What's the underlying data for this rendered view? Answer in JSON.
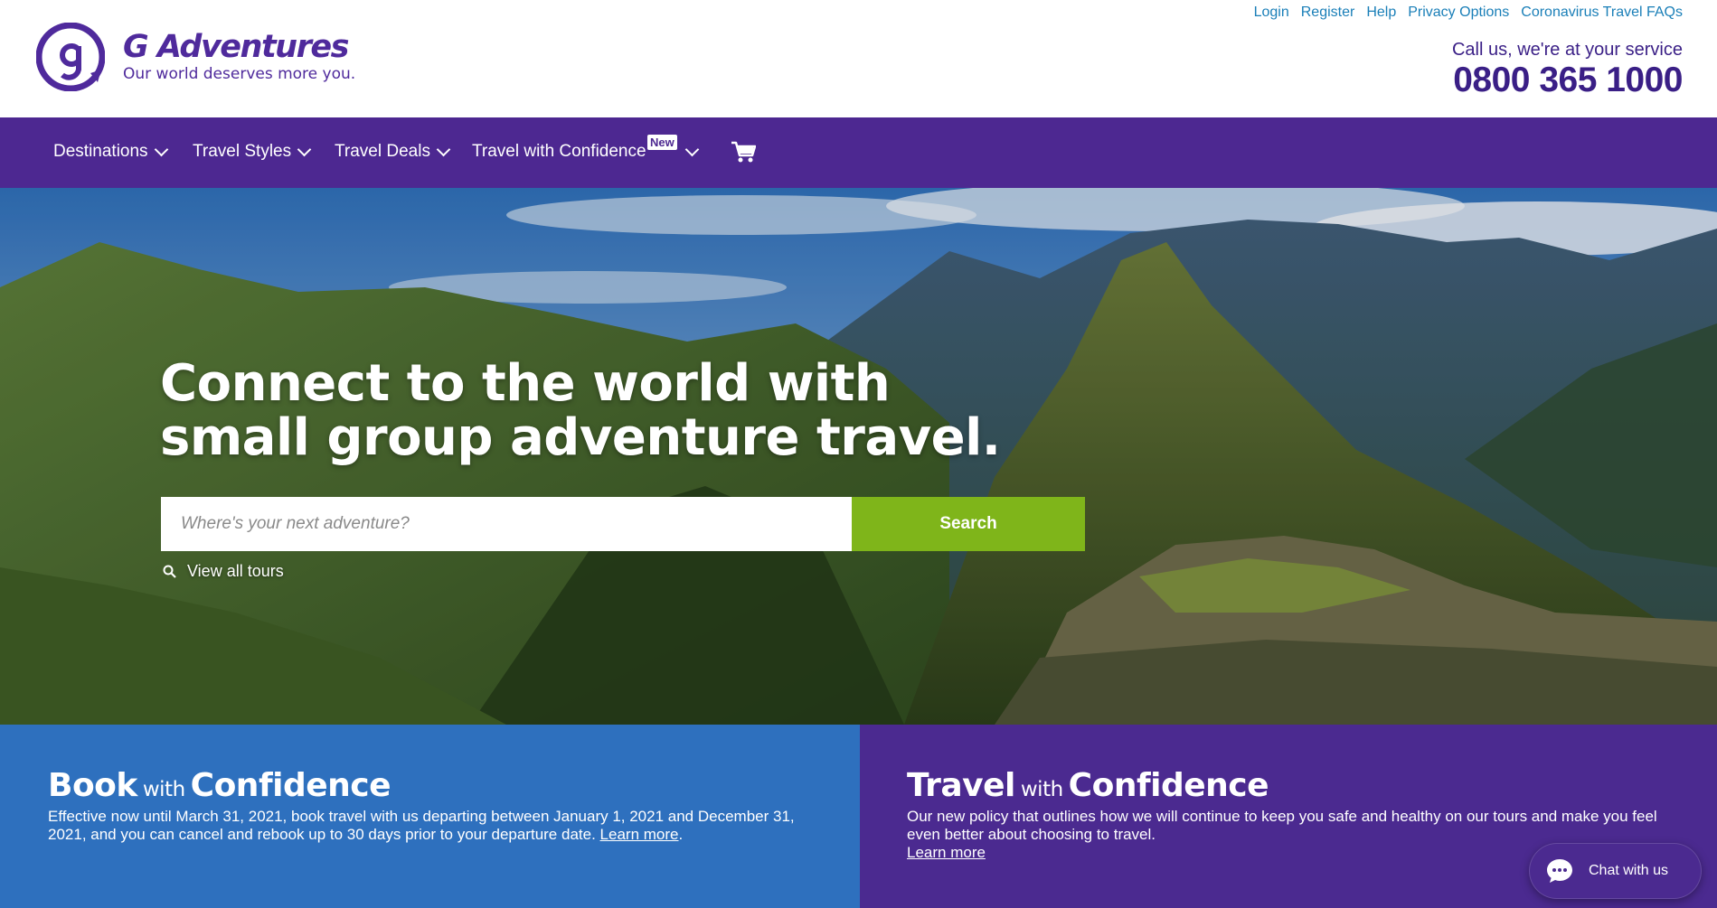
{
  "header": {
    "brand_name": "G Adventures",
    "brand_tagline": "Our world deserves more you.",
    "util_links": [
      "Login",
      "Register",
      "Help",
      "Privacy Options",
      "Coronavirus Travel FAQs"
    ],
    "call_text": "Call us, we're at your service",
    "phone": "0800 365 1000"
  },
  "nav": {
    "items": [
      "Destinations",
      "Travel Styles",
      "Travel Deals",
      "Travel with Confidence"
    ],
    "new_badge": "New",
    "cart_icon": "cart-icon"
  },
  "hero": {
    "title": "Connect to the world with small group adventure travel.",
    "search_placeholder": "Where's your next adventure?",
    "search_button": "Search",
    "view_all": "View all tours"
  },
  "panels": {
    "book": {
      "heading_1": "Book",
      "heading_with": "with",
      "heading_2": "Confidence",
      "body": "Effective now until March 31, 2021, book travel with us departing between January 1, 2021 and December 31, 2021, and you can cancel and rebook up to 30 days prior to your departure date.",
      "link": "Learn more",
      "suffix": "."
    },
    "travel": {
      "heading_1": "Travel",
      "heading_with": "with",
      "heading_2": "Confidence",
      "body": "Our new policy that outlines how we will continue to keep you safe and healthy on our tours and make you feel even better about choosing to travel.",
      "link": "Learn more"
    }
  },
  "chat": {
    "label": "Chat with us",
    "icon": "chat-bubble-icon"
  },
  "colors": {
    "brand_purple": "#4d2891",
    "link_blue": "#1a7fb8",
    "search_green": "#7fb51a",
    "panel_blue": "#2e70be",
    "panel_purple": "#4b2a90"
  }
}
